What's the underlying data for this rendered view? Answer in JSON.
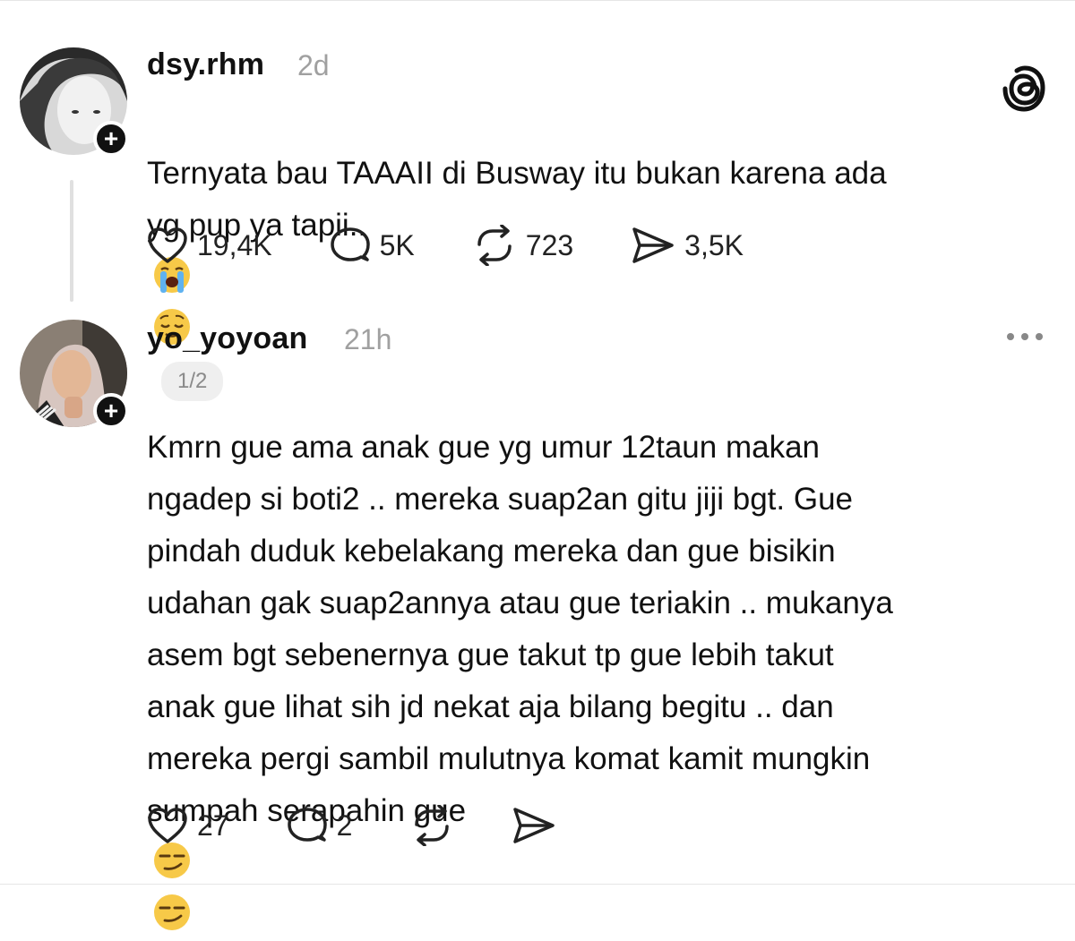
{
  "posts": [
    {
      "username": "dsy.rhm",
      "time": "2d",
      "text": "Ternyata bau TAAAII di Busway itu bukan karena ada\nyg pup ya tapii..",
      "emojis": [
        "loudly-crying-face",
        "relieved-face"
      ],
      "pager": "1/2",
      "likes": "19,4K",
      "replies": "5K",
      "reposts": "723",
      "shares": "3,5K"
    },
    {
      "username": "yo_yoyoan",
      "time": "21h",
      "text": "Kmrn gue ama anak gue yg umur 12taun makan\nngadep si boti2 .. mereka suap2an gitu jiji bgt.  Gue\npindah duduk kebelakang mereka dan gue bisikin\nudahan gak suap2annya atau gue teriakin .. mukanya\nasem bgt sebenernya gue takut tp gue lebih takut\nanak gue lihat sih jd nekat aja bilang begitu .. dan\nmereka pergi sambil mulutnya komat kamit mungkin\nsumpah serapahin gue",
      "emojis": [
        "smirking-face",
        "smirking-face"
      ],
      "likes": "27",
      "replies": "2"
    }
  ],
  "icons": {
    "logo": "threads-logo-icon",
    "more": "more-horizontal-icon",
    "like": "heart-icon",
    "reply": "comment-icon",
    "repost": "repost-icon",
    "share": "send-icon",
    "follow": "plus-icon"
  }
}
